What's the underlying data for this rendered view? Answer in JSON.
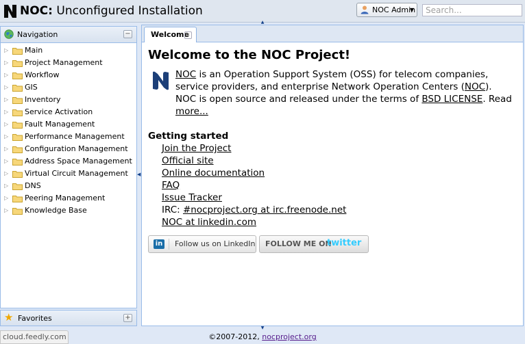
{
  "header": {
    "app_name": "NOC:",
    "app_subtitle": "Unconfigured Installation",
    "user_label": "NOC Admin",
    "search_placeholder": "Search..."
  },
  "navigation": {
    "title": "Navigation",
    "items": [
      "Main",
      "Project Management",
      "Workflow",
      "GIS",
      "Inventory",
      "Service Activation",
      "Fault Management",
      "Performance Management",
      "Configuration Management",
      "Address Space Management",
      "Virtual Circuit Management",
      "DNS",
      "Peering Management",
      "Knowledge Base"
    ]
  },
  "favorites": {
    "title": "Favorites"
  },
  "tabs": [
    {
      "label": "Welcome"
    }
  ],
  "welcome": {
    "heading": "Welcome to the NOC Project!",
    "intro_link_noc": "NOC",
    "intro_text_1": " is an Operation Support System (OSS) for telecom companies, service providers, and enterprise Network Operation Centers (",
    "intro_link_noc2": "NOC",
    "intro_text_2": ").",
    "intro_text_3": "NOC is open source and released under the terms of ",
    "intro_link_license": "BSD LICENSE",
    "intro_text_4": ". Read ",
    "intro_link_more": "more...",
    "getting_started": "Getting started",
    "links": {
      "join": "Join the Project",
      "site": "Official site",
      "docs": "Online documentation",
      "faq": "FAQ",
      "tracker": "Issue Tracker",
      "irc_prefix": "IRC: ",
      "irc_link": "#nocproject.org at irc.freenode.net",
      "linkedin": "NOC at linkedin.com"
    },
    "social": {
      "linkedin_icon": "in",
      "linkedin_label": "Follow us on LinkedIn",
      "twitter_label": "FOLLOW ME ON",
      "twitter_brand": "twitter"
    }
  },
  "footer": {
    "copyright": "©2007-2012, ",
    "link": "nocproject.org"
  },
  "statusbar": {
    "text": "cloud.feedly.com"
  },
  "colors": {
    "accent": "#15428b",
    "panel_border": "#99bbe8",
    "logo": "#1c3f78"
  }
}
